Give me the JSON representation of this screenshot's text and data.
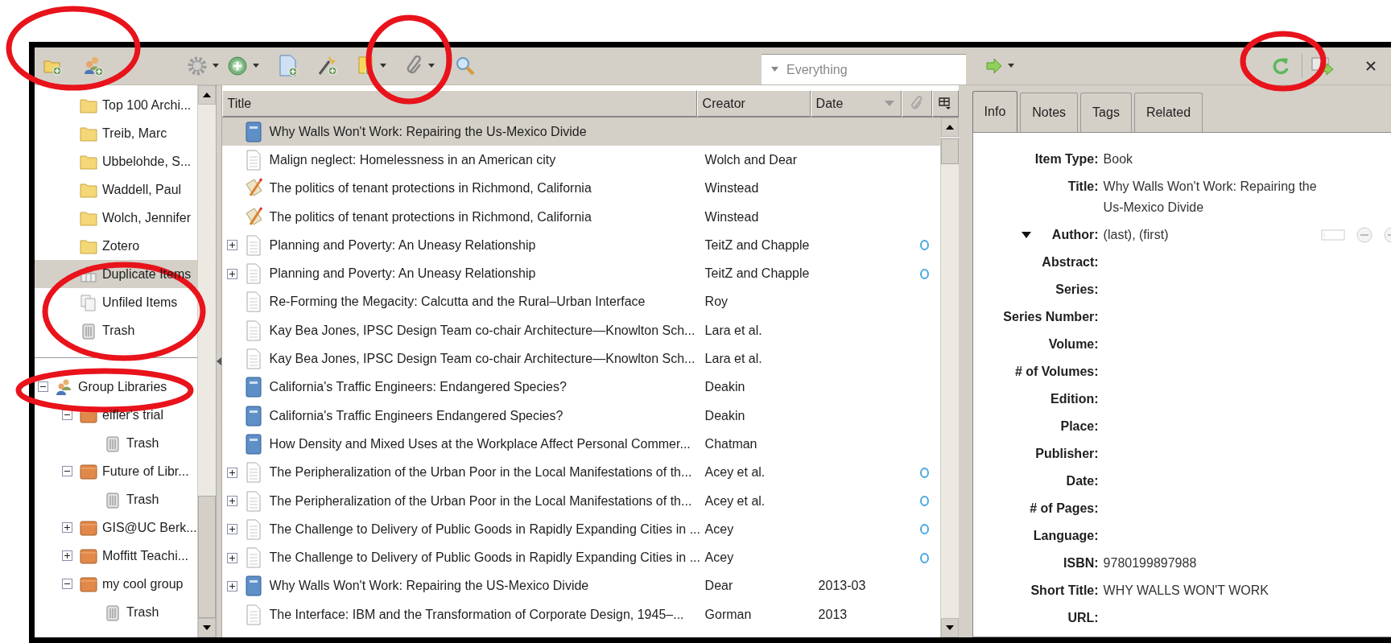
{
  "toolbar": {
    "search": {
      "mode": "Everything"
    }
  },
  "collections": [
    {
      "label": "Top 100 Archi...",
      "kind": "folder",
      "selected": false
    },
    {
      "label": "Treib, Marc",
      "kind": "folder",
      "selected": false
    },
    {
      "label": "Ubbelohde, S...",
      "kind": "folder",
      "selected": false
    },
    {
      "label": "Waddell, Paul",
      "kind": "folder",
      "selected": false
    },
    {
      "label": "Wolch, Jennifer",
      "kind": "folder",
      "selected": false
    },
    {
      "label": "Zotero",
      "kind": "folder",
      "selected": false
    },
    {
      "label": "Duplicate Items",
      "kind": "duplicate",
      "selected": true
    },
    {
      "label": "Unfiled Items",
      "kind": "unfiled",
      "selected": false
    },
    {
      "label": "Trash",
      "kind": "trash",
      "selected": false
    }
  ],
  "group_libraries": {
    "label": "Group Libraries",
    "kind": "group",
    "expanded": true,
    "selected": false,
    "children": [
      {
        "label": "eifler's trial",
        "kind": "library",
        "expanded": true,
        "selected": false,
        "children": [
          {
            "label": "Trash",
            "kind": "trash",
            "selected": false
          }
        ]
      },
      {
        "label": "Future of Libr...",
        "kind": "library",
        "expanded": true,
        "selected": false,
        "children": [
          {
            "label": "Trash",
            "kind": "trash",
            "selected": false
          }
        ]
      },
      {
        "label": "GIS@UC Berk...",
        "kind": "library",
        "expanded": false,
        "selected": false
      },
      {
        "label": "Moffitt Teachi...",
        "kind": "library",
        "expanded": false,
        "selected": false
      },
      {
        "label": "my cool group",
        "kind": "library",
        "expanded": true,
        "selected": false,
        "children": [
          {
            "label": "Trash",
            "kind": "trash",
            "selected": false
          }
        ]
      }
    ]
  },
  "items": {
    "columns": [
      "Title",
      "Creator",
      "Date"
    ],
    "rows": [
      {
        "title": "Why Walls Won't Work: Repairing the Us-Mexico Divide",
        "kind": "book",
        "has_children": false,
        "attachment": false,
        "selected": true
      },
      {
        "title": "Malign neglect: Homelessness in an American city",
        "creator": "Wolch and Dear",
        "kind": "document",
        "has_children": false,
        "attachment": false,
        "selected": false
      },
      {
        "title": "The politics of tenant protections in Richmond, California",
        "creator": "Winstead",
        "kind": "manuscript",
        "has_children": false,
        "attachment": false,
        "selected": false
      },
      {
        "title": "The politics of tenant protections in Richmond, California",
        "creator": "Winstead",
        "kind": "manuscript",
        "has_children": false,
        "attachment": false,
        "selected": false
      },
      {
        "title": "Planning and Poverty: An Uneasy Relationship",
        "creator": "TeitZ and Chapple",
        "kind": "document",
        "has_children": true,
        "attachment": true,
        "selected": false
      },
      {
        "title": "Planning and Poverty: An Uneasy Relationship",
        "creator": "TeitZ and Chapple",
        "kind": "document",
        "has_children": true,
        "attachment": true,
        "selected": false
      },
      {
        "title": "Re-Forming the Megacity: Calcutta and the Rural–Urban Interface",
        "creator": "Roy",
        "kind": "document",
        "has_children": false,
        "attachment": false,
        "selected": false
      },
      {
        "title": "Kay Bea Jones, IPSC Design Team co-chair Architecture—Knowlton Sch...",
        "creator": "Lara et al.",
        "kind": "document",
        "has_children": false,
        "attachment": false,
        "selected": false
      },
      {
        "title": "Kay Bea Jones, IPSC Design Team co-chair Architecture—Knowlton Sch...",
        "creator": "Lara et al.",
        "kind": "document",
        "has_children": false,
        "attachment": false,
        "selected": false
      },
      {
        "title": "California's Traffic Engineers: Endangered Species?",
        "creator": "Deakin",
        "kind": "book",
        "has_children": false,
        "attachment": false,
        "selected": false
      },
      {
        "title": "California's Traffic Engineers Endangered Species?",
        "creator": "Deakin",
        "kind": "book",
        "has_children": false,
        "attachment": false,
        "selected": false
      },
      {
        "title": "How Density and Mixed Uses at the Workplace Affect Personal Commer...",
        "creator": "Chatman",
        "kind": "book",
        "has_children": false,
        "attachment": false,
        "selected": false
      },
      {
        "title": "The Peripheralization of the Urban Poor in the Local Manifestations of th...",
        "creator": "Acey et al.",
        "kind": "document",
        "has_children": true,
        "attachment": true,
        "selected": false
      },
      {
        "title": "The Peripheralization of the Urban Poor in the Local Manifestations of th...",
        "creator": "Acey et al.",
        "kind": "document",
        "has_children": true,
        "attachment": true,
        "selected": false
      },
      {
        "title": "The Challenge to Delivery of Public Goods in Rapidly Expanding Cities in ...",
        "creator": "Acey",
        "kind": "document",
        "has_children": true,
        "attachment": true,
        "selected": false
      },
      {
        "title": "The Challenge to Delivery of Public Goods in Rapidly Expanding Cities in ...",
        "creator": "Acey",
        "kind": "document",
        "has_children": true,
        "attachment": true,
        "selected": false
      },
      {
        "title": "Why Walls Won't Work: Repairing the US-Mexico Divide",
        "creator": "Dear",
        "date": "2013-03",
        "kind": "book",
        "has_children": true,
        "attachment": false,
        "selected": false
      },
      {
        "title": "The Interface: IBM and the Transformation of Corporate Design, 1945–...",
        "creator": "Gorman",
        "date": "2013",
        "kind": "document",
        "has_children": false,
        "attachment": false,
        "selected": false
      }
    ]
  },
  "item_pane": {
    "tabs": [
      {
        "label": "Info",
        "selected": true
      },
      {
        "label": "Notes",
        "selected": false
      },
      {
        "label": "Tags",
        "selected": false
      },
      {
        "label": "Related",
        "selected": false
      }
    ],
    "fields": [
      {
        "label": "Item Type:",
        "value": "Book",
        "kind": "text"
      },
      {
        "label": "Title:",
        "value": "Why Walls Won't Work: Repairing the Us-Mexico Divide",
        "kind": "text"
      },
      {
        "label": "Author:",
        "value": "(last), (first)",
        "kind": "creator"
      },
      {
        "label": "Abstract:",
        "kind": "text"
      },
      {
        "label": "Series:",
        "kind": "text"
      },
      {
        "label": "Series Number:",
        "kind": "text"
      },
      {
        "label": "Volume:",
        "kind": "text"
      },
      {
        "label": "# of Volumes:",
        "kind": "text"
      },
      {
        "label": "Edition:",
        "kind": "text"
      },
      {
        "label": "Place:",
        "kind": "text"
      },
      {
        "label": "Publisher:",
        "kind": "text"
      },
      {
        "label": "Date:",
        "kind": "text"
      },
      {
        "label": "# of Pages:",
        "kind": "text"
      },
      {
        "label": "Language:",
        "kind": "text"
      },
      {
        "label": "ISBN:",
        "value": "9780199897988",
        "kind": "text"
      },
      {
        "label": "Short Title:",
        "value": "WHY WALLS WON'T WORK",
        "kind": "text"
      },
      {
        "label": "URL:",
        "kind": "text"
      }
    ]
  }
}
